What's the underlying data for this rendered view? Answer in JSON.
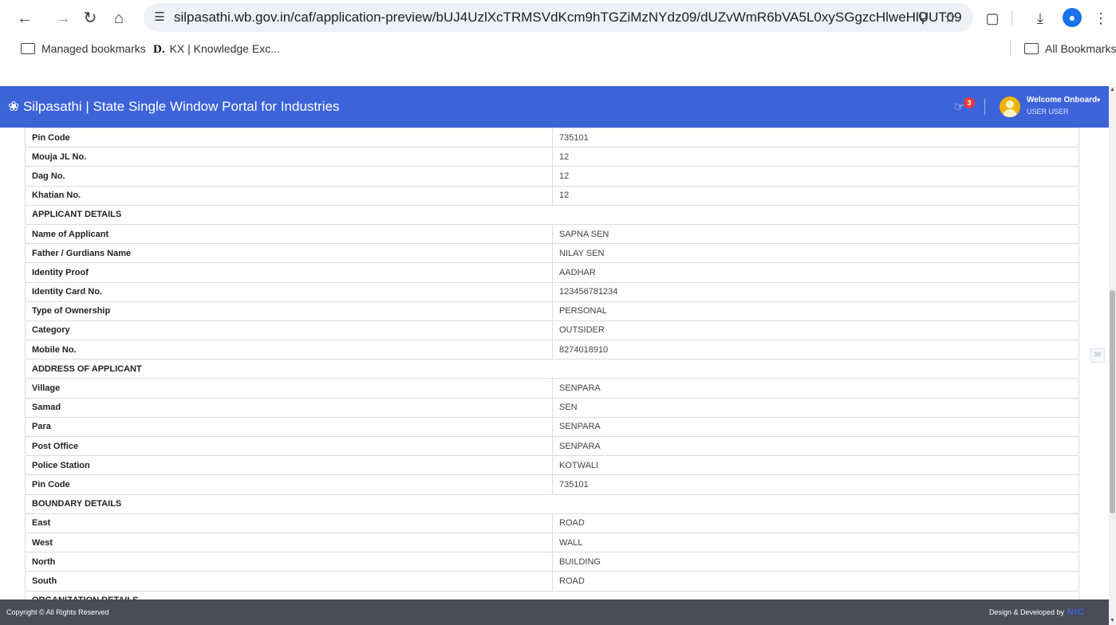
{
  "browser": {
    "url": "silpasathi.wb.gov.in/caf/application-preview/bUJ4UzlXcTRMSVdKcm9hTGZiMzNYdz09/dUZvWmR6bVA5L0xySGgzcHlweHlUUT09",
    "icons": [
      "back-icon",
      "forward-icon",
      "reload-icon",
      "home-icon",
      "site-settings-icon",
      "zoom-icon",
      "star-icon",
      "extensions-icon",
      "download-icon",
      "profile-icon",
      "menu-icon"
    ],
    "bookmarks": {
      "managed": "Managed bookmarks",
      "kx_prefix": "D.",
      "kx": "KX | Knowledge Exc...",
      "all": "All Bookmarks"
    }
  },
  "header": {
    "title": "Silpasathi | State Single Window Portal for Industries",
    "notification_count": "3",
    "welcome": "Welcome Onboard",
    "user_role": "USER USER",
    "accent_color": "#3d63d9"
  },
  "rows": [
    {
      "label": "Pin Code",
      "value": "735101"
    },
    {
      "label": "Mouja JL No.",
      "value": "12"
    },
    {
      "label": "Dag No.",
      "value": "12"
    },
    {
      "label": "Khatian No.",
      "value": "12"
    },
    {
      "section": "APPLICANT DETAILS"
    },
    {
      "label": "Name of Applicant",
      "value": "SAPNA SEN"
    },
    {
      "label": "Father / Gurdians Name",
      "value": "NILAY SEN"
    },
    {
      "label": "Identity Proof",
      "value": "AADHAR"
    },
    {
      "label": "Identity Card No.",
      "value": "123456781234"
    },
    {
      "label": "Type of Ownership",
      "value": "PERSONAL"
    },
    {
      "label": "Category",
      "value": "OUTSIDER"
    },
    {
      "label": "Mobile No.",
      "value": "8274018910"
    },
    {
      "section": "ADDRESS OF APPLICANT"
    },
    {
      "label": "Village",
      "value": "SENPARA"
    },
    {
      "label": "Samad",
      "value": "SEN"
    },
    {
      "label": "Para",
      "value": "SENPARA"
    },
    {
      "label": "Post Office",
      "value": "SENPARA"
    },
    {
      "label": "Police Station",
      "value": "KOTWALI"
    },
    {
      "label": "Pin Code",
      "value": "735101"
    },
    {
      "section": "BOUNDARY DETAILS"
    },
    {
      "label": "East",
      "value": "ROAD"
    },
    {
      "label": "West",
      "value": "WALL"
    },
    {
      "label": "North",
      "value": "BUILDING"
    },
    {
      "label": "South",
      "value": "ROAD"
    },
    {
      "section": "ORGANIZATION DETAILS"
    }
  ],
  "footer": {
    "copyright": "Copyright © All Rights Reserved",
    "credit": "Design & Developed by",
    "logo": "NIC"
  }
}
